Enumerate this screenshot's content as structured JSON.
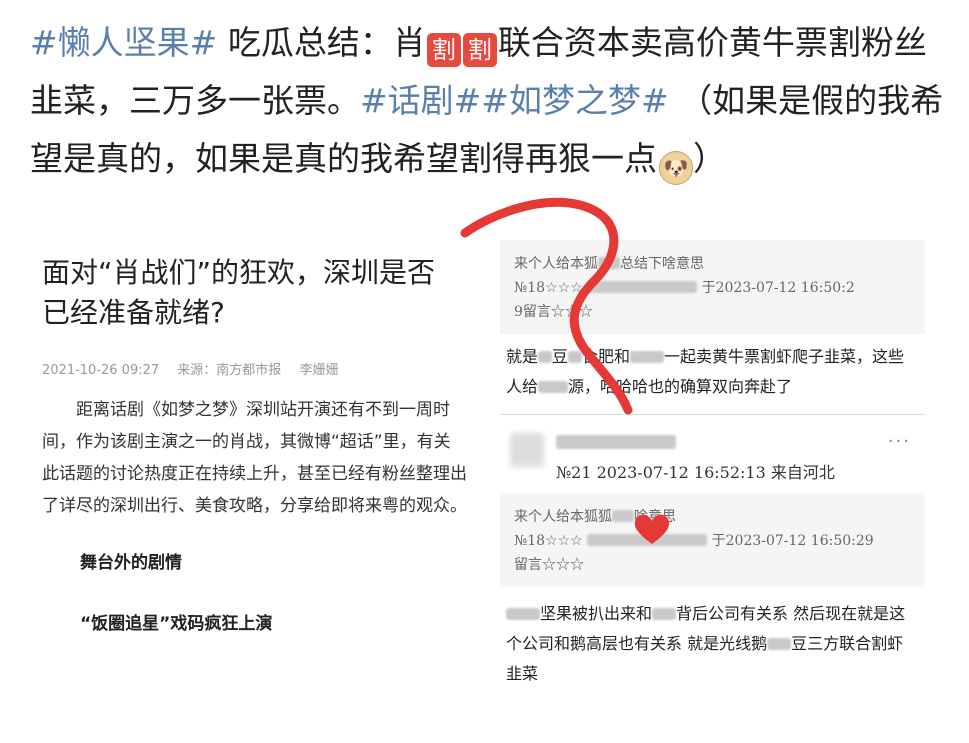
{
  "post": {
    "tag1": "#懒人坚果#",
    "p1": "吃瓜总结：肖",
    "cut_glyph": "割",
    "p2": "联合资本卖高价黄牛票割粉丝韭菜，三万多一张票。",
    "tag2": "#话剧##如梦之梦#",
    "p3": "（如果是假的我希望是真的，如果是真的我希望割得再狠一点",
    "emoji": "doge-emoji",
    "p4": "）"
  },
  "article": {
    "title": "面对“肖战们”的狂欢，深圳是否已经准备就绪?",
    "date": "2021-10-26 09:27",
    "source": "来源：南方都市报",
    "author": "李姗姗",
    "body": "距离话剧《如梦之梦》深圳站开演还有不到一周时间，作为该剧主演之一的肖战，其微博“超话”里，有关此话题的讨论热度正在持续上升，甚至已经有粉丝整理出了详尽的深圳出行、美食攻略，分享给即将来粤的观众。",
    "heading1": "舞台外的剧情",
    "heading2": "“饭圈追星”戏码疯狂上演"
  },
  "comments": {
    "quote1": {
      "line1": "来个人给本狐",
      "line1b": "总结下啥意思",
      "floor": "№18☆☆☆",
      "time": "于2023-07-12 16:50:2",
      "line3": "9留言☆☆☆"
    },
    "text1": "就是",
    "text1b": "豆",
    "text1c": "合肥和",
    "text1d": "一起卖黄牛票割虾爬子韭菜，这些人给",
    "text1e": "源，哈哈哈也的确算双向奔赴了",
    "item2": {
      "floor_time": "№21 2023-07-12 16:52:13 来自河北",
      "more": "···"
    },
    "quote2": {
      "line1": "来个人给本狐狐",
      "line1b": "啥意思",
      "floor": "№18☆☆☆",
      "time": "于2023-07-12 16:50:29",
      "line3": "留言☆☆☆"
    },
    "text2": "然后现在就是这个公司和鹅高层也有关系 就是光线鹅",
    "text2a": "坚果被扒出来和",
    "text2b": "背后公司有关系",
    "text2c": "豆三方联合割虾韭菜"
  },
  "colors": {
    "tag": "#5a7fae",
    "cut": "#e8493f",
    "scribble": "#e53935"
  }
}
